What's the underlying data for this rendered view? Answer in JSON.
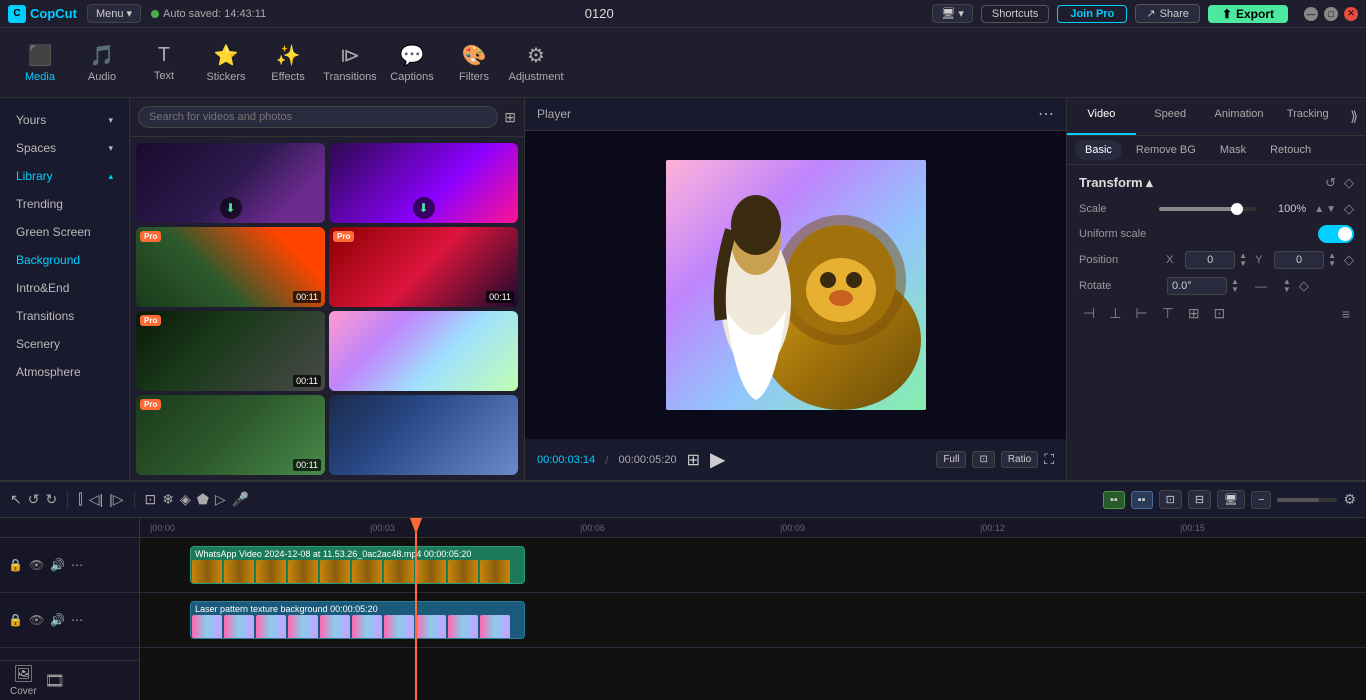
{
  "topbar": {
    "logo": "CopCut",
    "menu_label": "Menu",
    "auto_saved": "Auto saved: 14:43:11",
    "project_num": "0120",
    "shortcuts_label": "Shortcuts",
    "joinpro_label": "Join Pro",
    "share_label": "Share",
    "export_label": "Export"
  },
  "toolbar": {
    "items": [
      {
        "id": "media",
        "label": "Media",
        "icon": "🎬",
        "active": true
      },
      {
        "id": "audio",
        "label": "Audio",
        "icon": "🎵",
        "active": false
      },
      {
        "id": "text",
        "label": "Text",
        "icon": "T",
        "active": false
      },
      {
        "id": "stickers",
        "label": "Stickers",
        "icon": "⭐",
        "active": false
      },
      {
        "id": "effects",
        "label": "Effects",
        "icon": "✨",
        "active": false
      },
      {
        "id": "transitions",
        "label": "Transitions",
        "icon": "▷▷",
        "active": false
      },
      {
        "id": "captions",
        "label": "Captions",
        "icon": "💬",
        "active": false
      },
      {
        "id": "filters",
        "label": "Filters",
        "icon": "🎨",
        "active": false
      },
      {
        "id": "adjustment",
        "label": "Adjustment",
        "icon": "⚙",
        "active": false
      }
    ]
  },
  "left_panel": {
    "items": [
      {
        "id": "yours",
        "label": "Yours",
        "has_arrow": true,
        "active": false
      },
      {
        "id": "spaces",
        "label": "Spaces",
        "has_arrow": true,
        "active": false
      },
      {
        "id": "library",
        "label": "Library",
        "has_arrow": true,
        "active": true
      },
      {
        "id": "trending",
        "label": "Trending",
        "has_arrow": false,
        "active": false
      },
      {
        "id": "green-screen",
        "label": "Green Screen",
        "has_arrow": false,
        "active": false
      },
      {
        "id": "background",
        "label": "Background",
        "has_arrow": false,
        "active": true
      },
      {
        "id": "intro-end",
        "label": "Intro&End",
        "has_arrow": false,
        "active": false
      },
      {
        "id": "transitions",
        "label": "Transitions",
        "has_arrow": false,
        "active": false
      },
      {
        "id": "scenery",
        "label": "Scenery",
        "has_arrow": false,
        "active": false
      },
      {
        "id": "atmosphere",
        "label": "Atmosphere",
        "has_arrow": false,
        "active": false
      }
    ]
  },
  "media_panel": {
    "search_placeholder": "Search for videos and photos",
    "thumbnails": [
      {
        "id": 1,
        "class": "thumb-dark-blobs",
        "badge": null,
        "duration": null,
        "has_download": true
      },
      {
        "id": 2,
        "class": "thumb-2",
        "badge": null,
        "duration": null,
        "has_download": true
      },
      {
        "id": 3,
        "class": "thumb-3",
        "badge": "Pro",
        "duration": "00:11",
        "has_download": false
      },
      {
        "id": 4,
        "class": "thumb-4",
        "badge": "Pro",
        "duration": "00:11",
        "has_download": false
      },
      {
        "id": 5,
        "class": "thumb-5",
        "badge": "Pro",
        "duration": "00:11",
        "has_download": false
      },
      {
        "id": 6,
        "class": "thumb-laser",
        "badge": null,
        "duration": null,
        "has_download": false
      },
      {
        "id": 7,
        "class": "thumb-green1",
        "badge": "Pro",
        "duration": "00:11",
        "has_download": false
      },
      {
        "id": 8,
        "class": "thumb-pink-multi",
        "badge": null,
        "duration": null,
        "has_download": false
      }
    ]
  },
  "player": {
    "title": "Player",
    "time_current": "00:00:03:14",
    "time_total": "00:00:05:20",
    "controls": {
      "full_label": "Full",
      "ratio_label": "Ratio"
    }
  },
  "right_panel": {
    "tabs": [
      "Video",
      "Speed",
      "Animation",
      "Tracking"
    ],
    "sub_tabs": [
      "Basic",
      "Remove BG",
      "Mask",
      "Retouch"
    ],
    "transform": {
      "title": "Transform",
      "scale_label": "Scale",
      "scale_value": "100%",
      "uniform_scale_label": "Uniform scale",
      "position_label": "Position",
      "x_label": "X",
      "x_value": "0",
      "y_label": "Y",
      "y_value": "0",
      "rotate_label": "Rotate",
      "rotate_value": "0.0°",
      "rotate_dash": "—"
    }
  },
  "timeline": {
    "tracks": [
      {
        "id": "track1",
        "clip_label": "WhatsApp Video 2024-12-08 at 11.53.26_0ac2ac48.mp4",
        "clip_duration": "00:00:05:20",
        "type": "video"
      },
      {
        "id": "track2",
        "clip_label": "Laser pattern texture background",
        "clip_duration": "00:00:05:20",
        "type": "background"
      }
    ],
    "ruler_marks": [
      "00:00",
      "00:03",
      "00:06",
      "00:09",
      "00:12",
      "00:15"
    ],
    "cover_label": "Cover"
  }
}
